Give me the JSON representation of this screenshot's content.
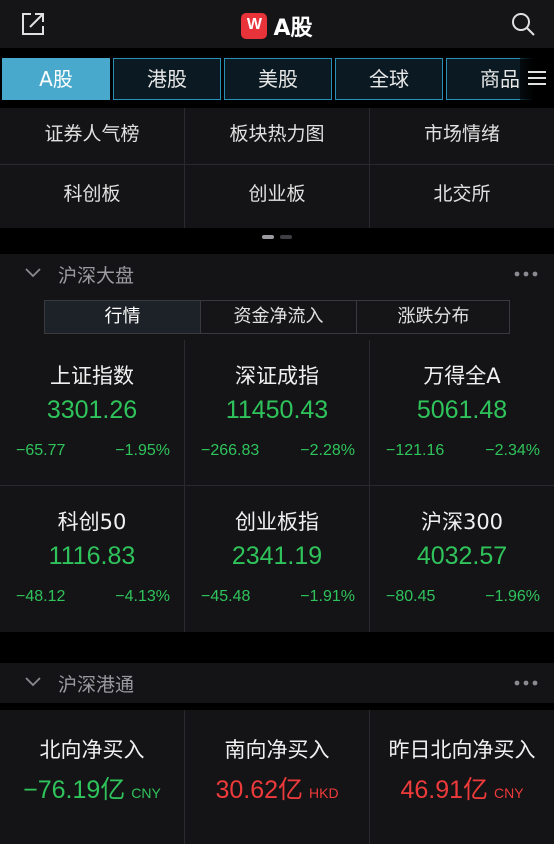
{
  "header": {
    "title": "A股",
    "logo_text": "W",
    "logo_color": "#e8333b",
    "left_icon": "external-link-icon",
    "right_icon": "search-icon"
  },
  "market_tabs": [
    {
      "label": "A股",
      "active": true
    },
    {
      "label": "港股",
      "active": false
    },
    {
      "label": "美股",
      "active": false
    },
    {
      "label": "全球",
      "active": false
    },
    {
      "label": "商品",
      "active": false
    }
  ],
  "quick_links": [
    {
      "label": "证券人气榜"
    },
    {
      "label": "板块热力图"
    },
    {
      "label": "市场情绪"
    },
    {
      "label": "科创板"
    },
    {
      "label": "创业板"
    },
    {
      "label": "北交所"
    }
  ],
  "market_section": {
    "title": "沪深大盘",
    "subtabs": [
      "行情",
      "资金净流入",
      "涨跌分布"
    ],
    "active_subtab": 0,
    "indices": [
      {
        "name": "上证指数",
        "value": "3301.26",
        "change": "−65.77",
        "pct": "−1.95%"
      },
      {
        "name": "深证成指",
        "value": "11450.43",
        "change": "−266.83",
        "pct": "−2.28%"
      },
      {
        "name": "万得全A",
        "value": "5061.48",
        "change": "−121.16",
        "pct": "−2.34%"
      },
      {
        "name": "科创50",
        "value": "1116.83",
        "change": "−48.12",
        "pct": "−4.13%"
      },
      {
        "name": "创业板指",
        "value": "2341.19",
        "change": "−45.48",
        "pct": "−1.91%"
      },
      {
        "name": "沪深300",
        "value": "4032.57",
        "change": "−80.45",
        "pct": "−1.96%"
      }
    ]
  },
  "connect_section": {
    "title": "沪深港通",
    "flows": [
      {
        "name": "北向净买入",
        "amount": "−76.19亿",
        "currency": "CNY",
        "color": "green"
      },
      {
        "name": "南向净买入",
        "amount": "30.62亿",
        "currency": "HKD",
        "color": "red"
      },
      {
        "name": "昨日北向净买入",
        "amount": "46.91亿",
        "currency": "CNY",
        "color": "red"
      }
    ]
  },
  "colors": {
    "up": "#ee3a3a",
    "down": "#2fc35b",
    "accent": "#49a9cc"
  }
}
